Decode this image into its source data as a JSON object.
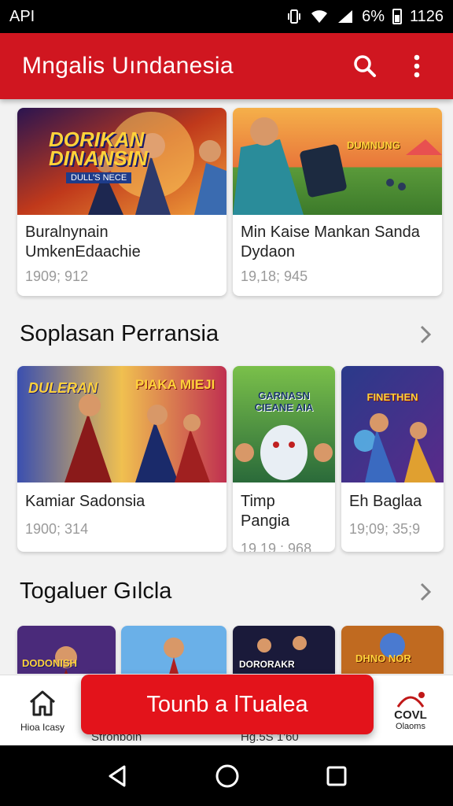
{
  "status_bar": {
    "carrier": "API",
    "battery": "6%",
    "time": "1126"
  },
  "app_bar": {
    "title": "Mngalis Uındanesia",
    "search_icon": "search-icon",
    "more_icon": "more-vert-icon"
  },
  "featured": [
    {
      "banner_text": "DORIKAN DINANSIN",
      "banner_sub": "DULL'S NECE",
      "name_line1": "Buralnynain",
      "name_line2": "UmkenEdaachie",
      "meta": "1909; 912"
    },
    {
      "banner_text": "DUMNUNG",
      "name_line1": "Min Kaise Mankan Sanda",
      "name_line2": "Dydaon",
      "meta": "19,18; 945"
    }
  ],
  "sections": [
    {
      "title": "Soplasan Perransia",
      "items": [
        {
          "banner_text": "DULERAN",
          "banner_text2": "PIAKA MIEJI",
          "name": "Kamiar Sadonsia",
          "meta": "1900; 314"
        },
        {
          "banner_text": "GARNASN CIEANE AIA",
          "name": "Timp Pangia",
          "meta": "19,19 : 968"
        },
        {
          "banner_text": "FINETHEN",
          "name": "Eh Baglaa",
          "meta": "19;09; 35;9"
        }
      ]
    },
    {
      "title": "Togaluer Gılcla",
      "items": [
        {
          "banner_text": "DODONISH"
        },
        {
          "banner_text": ""
        },
        {
          "banner_text": "DORORAKR"
        },
        {
          "banner_text": "DHNO NOR"
        }
      ],
      "peek_names": [
        "Stronboin",
        "Hg.5S 1'60"
      ]
    }
  ],
  "bottom_nav": {
    "home_label": "Hioa Icasy",
    "right_label_1": "COVL",
    "right_label_2": "Olaoms"
  },
  "cta": {
    "label": "Tounb a lTualea"
  },
  "colors": {
    "accent": "#d01620",
    "cta": "#e3131b"
  }
}
